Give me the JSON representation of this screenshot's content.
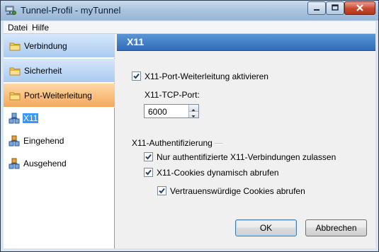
{
  "window": {
    "title": "Tunnel-Profil - myTunnel",
    "app_icon": "network-drive-icon"
  },
  "menu": {
    "items": [
      "Datei",
      "Hilfe"
    ]
  },
  "sidebar": {
    "categories": [
      {
        "label": "Verbindung",
        "icon": "folder-icon",
        "active": false
      },
      {
        "label": "Sicherheit",
        "icon": "folder-icon",
        "active": false
      },
      {
        "label": "Port-Weiterleitung",
        "icon": "folder-icon",
        "active": true
      }
    ],
    "items": [
      {
        "label": "X11",
        "icon": "network-plug-icon",
        "selected": true
      },
      {
        "label": "Eingehend",
        "icon": "network-plug-icon",
        "selected": false
      },
      {
        "label": "Ausgehend",
        "icon": "network-plug-icon",
        "selected": false
      }
    ]
  },
  "panel": {
    "title": "X11",
    "enable_label": "X11-Port-Weiterleitung aktivieren",
    "enable_checked": true,
    "port_label": "X11-TCP-Port:",
    "port_value": "6000",
    "auth_group": "X11-Authentifizierung",
    "auth_options": [
      {
        "label": "Nur authentifizierte X11-Verbindungen zulassen",
        "checked": true
      },
      {
        "label": "X11-Cookies dynamisch abrufen",
        "checked": true
      },
      {
        "label": "Vertrauenswürdige Cookies abrufen",
        "checked": true
      }
    ]
  },
  "buttons": {
    "ok": "OK",
    "cancel": "Abbrechen"
  },
  "colors": {
    "accent": "#2f6db7",
    "active_category": "#f6a85c",
    "category": "#a9cbf1",
    "selection": "#3399ff"
  }
}
